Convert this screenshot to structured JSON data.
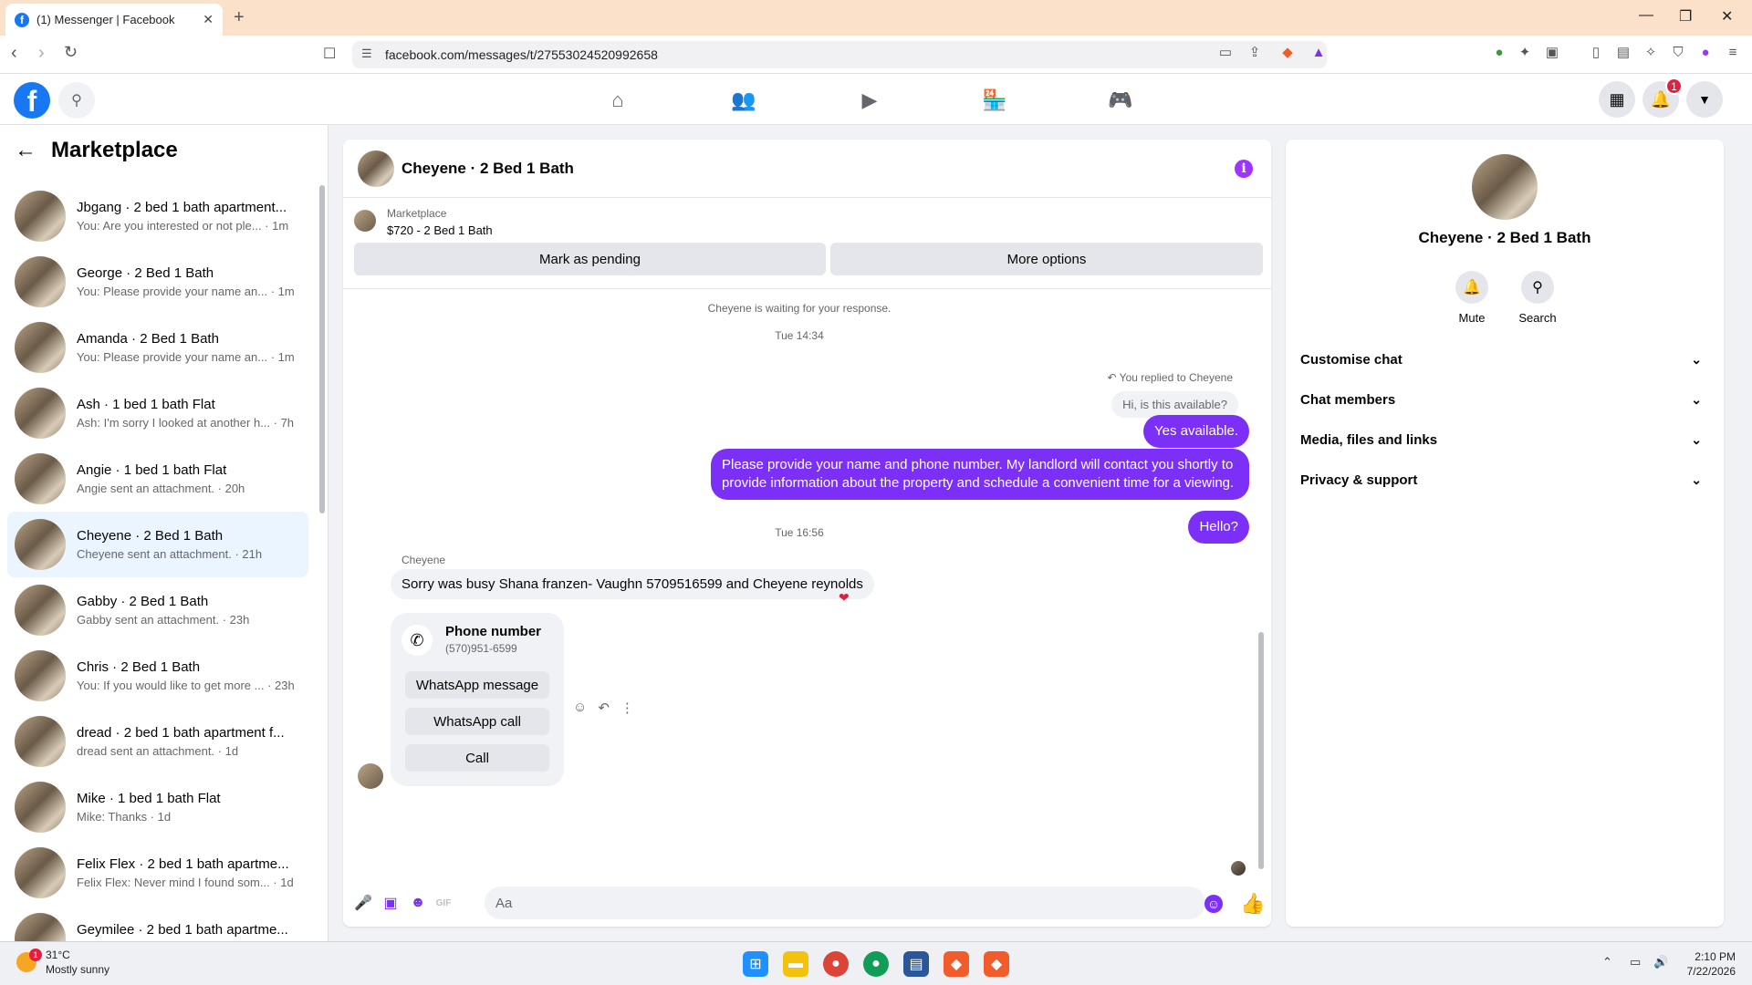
{
  "browser": {
    "tab_title": "(1) Messenger | Facebook",
    "new_tab": "+",
    "url": "facebook.com/messages/t/27553024520992658"
  },
  "header": {
    "notification_count": "1"
  },
  "sidebar": {
    "title": "Marketplace",
    "conversations": [
      {
        "name": "Jbgang · 2 bed 1 bath apartment...",
        "snippet": "You: Are you interested or not ple... · 1m"
      },
      {
        "name": "George · 2 Bed 1 Bath",
        "snippet": "You: Please provide your name an... · 1m"
      },
      {
        "name": "Amanda · 2 Bed 1 Bath",
        "snippet": "You: Please provide your name an... · 1m"
      },
      {
        "name": "Ash · 1 bed 1 bath Flat",
        "snippet": "Ash: I'm sorry I looked at another h... · 7h"
      },
      {
        "name": "Angie · 1 bed 1 bath Flat",
        "snippet": "Angie sent an attachment. · 20h"
      },
      {
        "name": "Cheyene · 2 Bed 1 Bath",
        "snippet": "Cheyene sent an attachment. · 21h",
        "active": true
      },
      {
        "name": "Gabby · 2 Bed 1 Bath",
        "snippet": "Gabby sent an attachment. · 23h"
      },
      {
        "name": "Chris · 2 Bed 1 Bath",
        "snippet": "You: If you would like to get more ... · 23h"
      },
      {
        "name": "dread · 2 bed 1 bath apartment f...",
        "snippet": "dread sent an attachment. · 1d"
      },
      {
        "name": "Mike · 1 bed 1 bath Flat",
        "snippet": "Mike: Thanks · 1d"
      },
      {
        "name": "Felix Flex · 2 bed 1 bath apartme...",
        "snippet": "Felix Flex: Never mind I found som... · 1d"
      },
      {
        "name": "Geymilee · 2 bed 1 bath apartme...",
        "snippet": "Geymilee sent an attachment. · 1d"
      }
    ]
  },
  "chat": {
    "title": "Cheyene · 2 Bed 1 Bath",
    "listing_label": "Marketplace",
    "listing_price": "$720 - 2 Bed 1 Bath",
    "mark_pending": "Mark as pending",
    "more_options": "More options",
    "waiting_note": "Cheyene is waiting for your response.",
    "time1": "Tue 14:34",
    "replied_note": "You replied to Cheyene",
    "quoted": "Hi, is this available?",
    "out1": "Yes available.",
    "out2": "Please provide your name and phone number. My landlord will contact you shortly to provide information about the property and schedule a convenient time for a viewing.",
    "out3": "Hello?",
    "time2": "Tue 16:56",
    "sender": "Cheyene",
    "in1": "Sorry was busy Shana franzen- Vaughn 5709516599 and Cheyene reynolds",
    "card_title": "Phone number",
    "card_number": "(570)951-6599",
    "card_btn1": "WhatsApp message",
    "card_btn2": "WhatsApp call",
    "card_btn3": "Call",
    "composer_placeholder": "Aa"
  },
  "rpanel": {
    "name": "Cheyene · 2 Bed 1 Bath",
    "mute": "Mute",
    "search": "Search",
    "sections": [
      "Customise chat",
      "Chat members",
      "Media, files and links",
      "Privacy & support"
    ]
  },
  "taskbar": {
    "temp": "31°C",
    "weather": "Mostly sunny",
    "weather_badge": "1",
    "time": "2:10 PM",
    "date": "7/22/2026"
  },
  "colors": {
    "accent": "#7b2ff7",
    "fb_blue": "#1877f2",
    "active_row": "#ebf5ff"
  }
}
